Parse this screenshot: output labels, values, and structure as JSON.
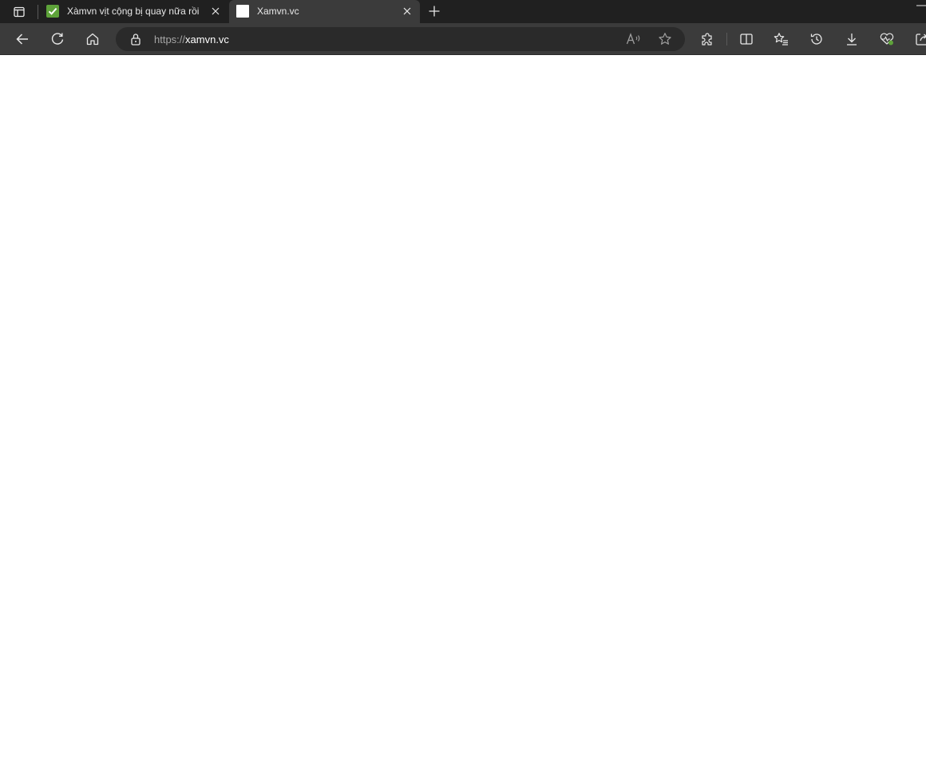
{
  "browser": {
    "tabs": [
      {
        "title": "Xàmvn vịt cộng bị quay nữa rồi",
        "favicon": "green-check-icon",
        "active": false
      },
      {
        "title": "Xamvn.vc",
        "favicon": "blank-page-icon",
        "active": true
      }
    ],
    "address": {
      "scheme": "https://",
      "host": "xamvn.vc"
    },
    "colors": {
      "tab_strip": "#202020",
      "toolbar": "#3b3b3b",
      "address_bar": "#2a2a2a",
      "favicon_check": "#5ea33a",
      "page_background": "#ffffff"
    },
    "toolbar_icons": [
      "back-arrow-icon",
      "refresh-icon",
      "home-icon",
      "lock-icon",
      "read-aloud-icon",
      "favorite-star-icon",
      "extensions-icon",
      "split-screen-icon",
      "favorites-icon",
      "history-icon",
      "downloads-icon",
      "browser-essentials-icon",
      "share-icon"
    ]
  }
}
